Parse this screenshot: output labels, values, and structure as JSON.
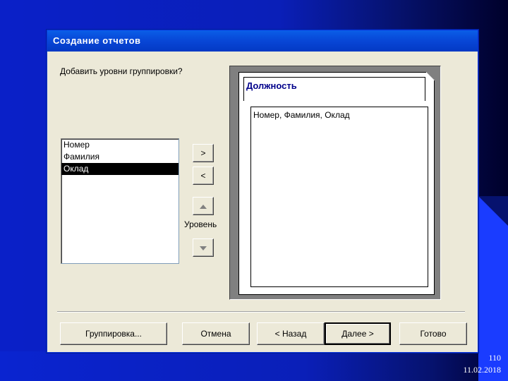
{
  "window": {
    "title": "Создание отчетов"
  },
  "wizard": {
    "question": "Добавить уровни группировки?",
    "fields": [
      {
        "label": "Номер",
        "selected": false
      },
      {
        "label": "Фамилия",
        "selected": false
      },
      {
        "label": "Оклад",
        "selected": true
      }
    ],
    "add_button": ">",
    "remove_button": "<",
    "level_label": "Уровень",
    "preview": {
      "group_header": "Должность",
      "detail_fields": "Номер, Фамилия, Оклад"
    }
  },
  "buttons": {
    "grouping": "Группировка...",
    "cancel": "Отмена",
    "back": "< Назад",
    "next": "Далее >",
    "finish": "Готово"
  },
  "slide": {
    "number": "110",
    "date": "11.02.2018"
  }
}
